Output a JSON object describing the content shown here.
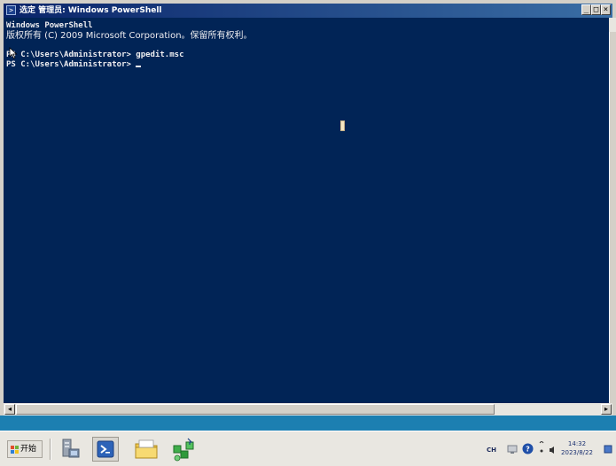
{
  "window": {
    "title": "选定 管理员: Windows PowerShell",
    "controls": [
      "_",
      "□",
      "×"
    ]
  },
  "console": {
    "lines": [
      {
        "text": "Windows PowerShell"
      },
      {
        "text": "版权所有 (C) 2009 Microsoft Corporation。保留所有权利。"
      },
      {
        "text": ""
      },
      {
        "text": "PS C:\\Users\\Administrator> gpedit.msc"
      },
      {
        "text": "PS C:\\Users\\Administrator> "
      }
    ]
  },
  "taskbar": {
    "start_label": "开始",
    "apps": [
      {
        "name": "server-manager-icon",
        "active": false
      },
      {
        "name": "powershell-icon",
        "active": true
      },
      {
        "name": "explorer-folder-icon",
        "active": false
      },
      {
        "name": "network-tool-icon",
        "active": false
      }
    ],
    "tray": {
      "ime": "CH",
      "time": "14:32",
      "date": "2023/8/22"
    }
  },
  "colors": {
    "console_bg": "#012456",
    "console_fg": "#eeedf0",
    "title_active": "#0a246a",
    "desktop": "#1c7fb1"
  }
}
